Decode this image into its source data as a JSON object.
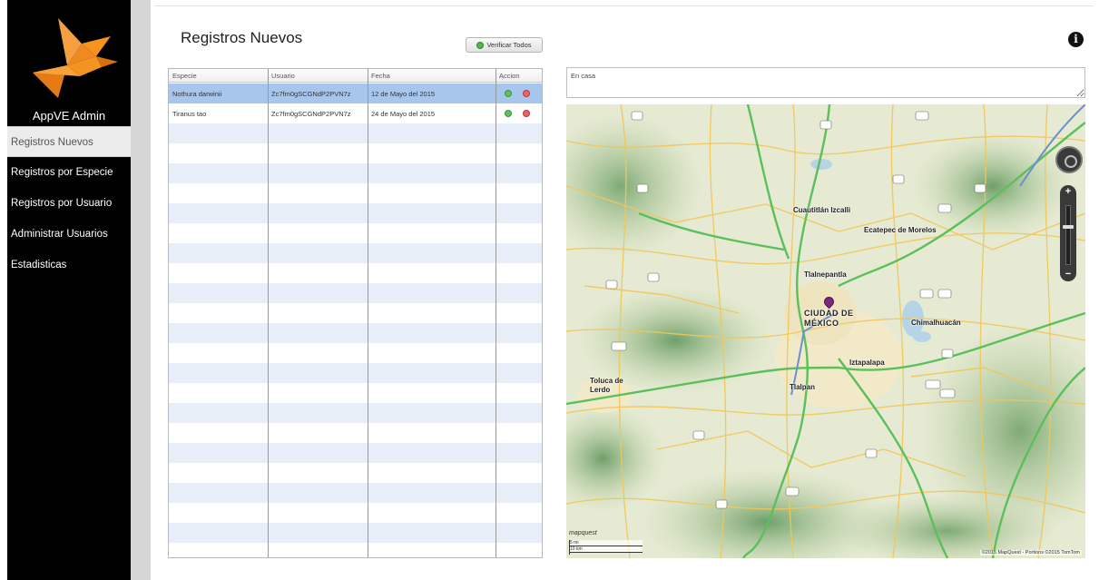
{
  "app": {
    "title": "AppVE Admin",
    "accent": "#f7931e"
  },
  "sidebar": {
    "items": [
      {
        "label": "Registros Nuevos",
        "active": true
      },
      {
        "label": "Registros por Especie",
        "active": false
      },
      {
        "label": "Registros por Usuario",
        "active": false
      },
      {
        "label": "Administrar Usuarios",
        "active": false
      },
      {
        "label": "Estadisticas",
        "active": false
      }
    ]
  },
  "page": {
    "title": "Registros Nuevos",
    "verify_all_label": "Verificar Todos",
    "info_icon": "info-icon"
  },
  "table": {
    "headers": [
      "Especie",
      "Usuario",
      "Fecha",
      "Accion"
    ],
    "rows": [
      {
        "especie": "Nothura darwinii",
        "usuario": "Zc7fm0gSCGNdP2PVN7z",
        "fecha": "12 de Mayo del 2015",
        "selected": true
      },
      {
        "especie": "Tiranus tao",
        "usuario": "Zc7fm0gSCGNdP2PVN7z",
        "fecha": "24 de Mayo del 2015",
        "selected": false
      }
    ]
  },
  "search": {
    "value": "En casa"
  },
  "map": {
    "labels": {
      "cuautitlan": "Cuautitlán Izcalli",
      "ecatepec": "Ecatepec de Morelos",
      "tlalnepantla": "Tlalnepantla",
      "ciudad": "CIUDAD DE MÉXICO",
      "chimalhuacan": "Chimalhuacán",
      "iztapalapa": "Iztapalapa",
      "toluca": "Toluca de Lerdo",
      "tlalpan": "Tlalpan"
    },
    "provider": "mapquest",
    "copyright": "©2015 MapQuest - Portions ©2015 TomTom",
    "scale_mi": "5 mi",
    "scale_km": "10 km"
  }
}
